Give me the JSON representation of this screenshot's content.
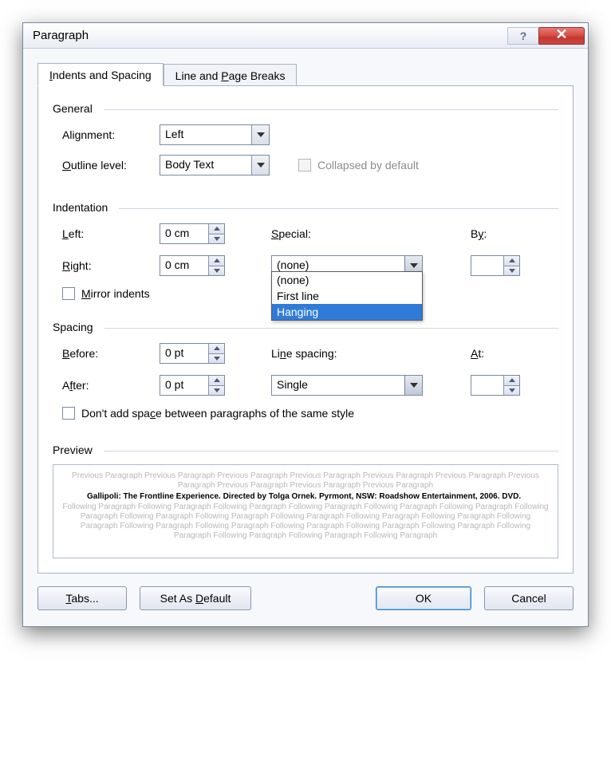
{
  "window": {
    "title": "Paragraph"
  },
  "titlebar": {
    "help": "?",
    "close": "✕"
  },
  "tabs": {
    "t1_pre": "I",
    "t1_rest": "ndents and Spacing",
    "t2_pre": "L",
    "t2_mid": "ine and ",
    "t2_u": "P",
    "t2_rest": "age Breaks"
  },
  "general": {
    "legend": "General",
    "alignment_label_pre": "Ali",
    "alignment_label_u": "g",
    "alignment_label_rest": "nment:",
    "alignment_value": "Left",
    "outline_label_u": "O",
    "outline_label_rest": "utline level:",
    "outline_value": "Body Text",
    "collapsed_label": "Collapsed by default"
  },
  "indent": {
    "legend": "Indentation",
    "left_u": "L",
    "left_rest": "eft:",
    "left_value": "0 cm",
    "right_u": "R",
    "right_rest": "ight:",
    "right_value": "0 cm",
    "special_u": "S",
    "special_rest": "pecial:",
    "special_value": "(none)",
    "by_pre": "B",
    "by_u": "y",
    "by_rest": ":",
    "by_value": "",
    "mirror_u": "M",
    "mirror_rest": "irror indents",
    "options": {
      "o1": "(none)",
      "o2": "First line",
      "o3": "Hanging"
    }
  },
  "spacing": {
    "legend": "Spacing",
    "before_u": "B",
    "before_rest": "efore:",
    "before_value": "0 pt",
    "after_pre": "A",
    "after_u": "f",
    "after_rest": "ter:",
    "after_value": "0 pt",
    "line_pre": "Li",
    "line_u": "n",
    "line_rest": "e spacing:",
    "line_value": "Single",
    "at_u": "A",
    "at_rest": "t:",
    "at_value": "",
    "dontadd_pre": "Don't add spa",
    "dontadd_u": "c",
    "dontadd_rest": "e between paragraphs of the same style"
  },
  "preview": {
    "legend": "Preview",
    "prev_line": "Previous Paragraph Previous Paragraph Previous Paragraph Previous Paragraph Previous Paragraph Previous Paragraph Previous Paragraph Previous Paragraph Previous Paragraph Previous Paragraph",
    "sample": "Gallipoli: The Frontline Experience. Directed by Tolga Ornek. Pyrmont, NSW: Roadshow Entertainment, 2006. DVD.",
    "follow_line": "Following Paragraph Following Paragraph Following Paragraph Following Paragraph Following Paragraph Following Paragraph Following Paragraph Following Paragraph Following Paragraph Following Paragraph Following Paragraph Following Paragraph Following Paragraph Following Paragraph Following Paragraph Following Paragraph Following Paragraph Following Paragraph Following Paragraph Following Paragraph Following Paragraph Following Paragraph"
  },
  "footer": {
    "tabs_u": "T",
    "tabs_rest": "abs...",
    "default_pre": "Set As ",
    "default_u": "D",
    "default_rest": "efault",
    "ok": "OK",
    "cancel": "Cancel"
  }
}
